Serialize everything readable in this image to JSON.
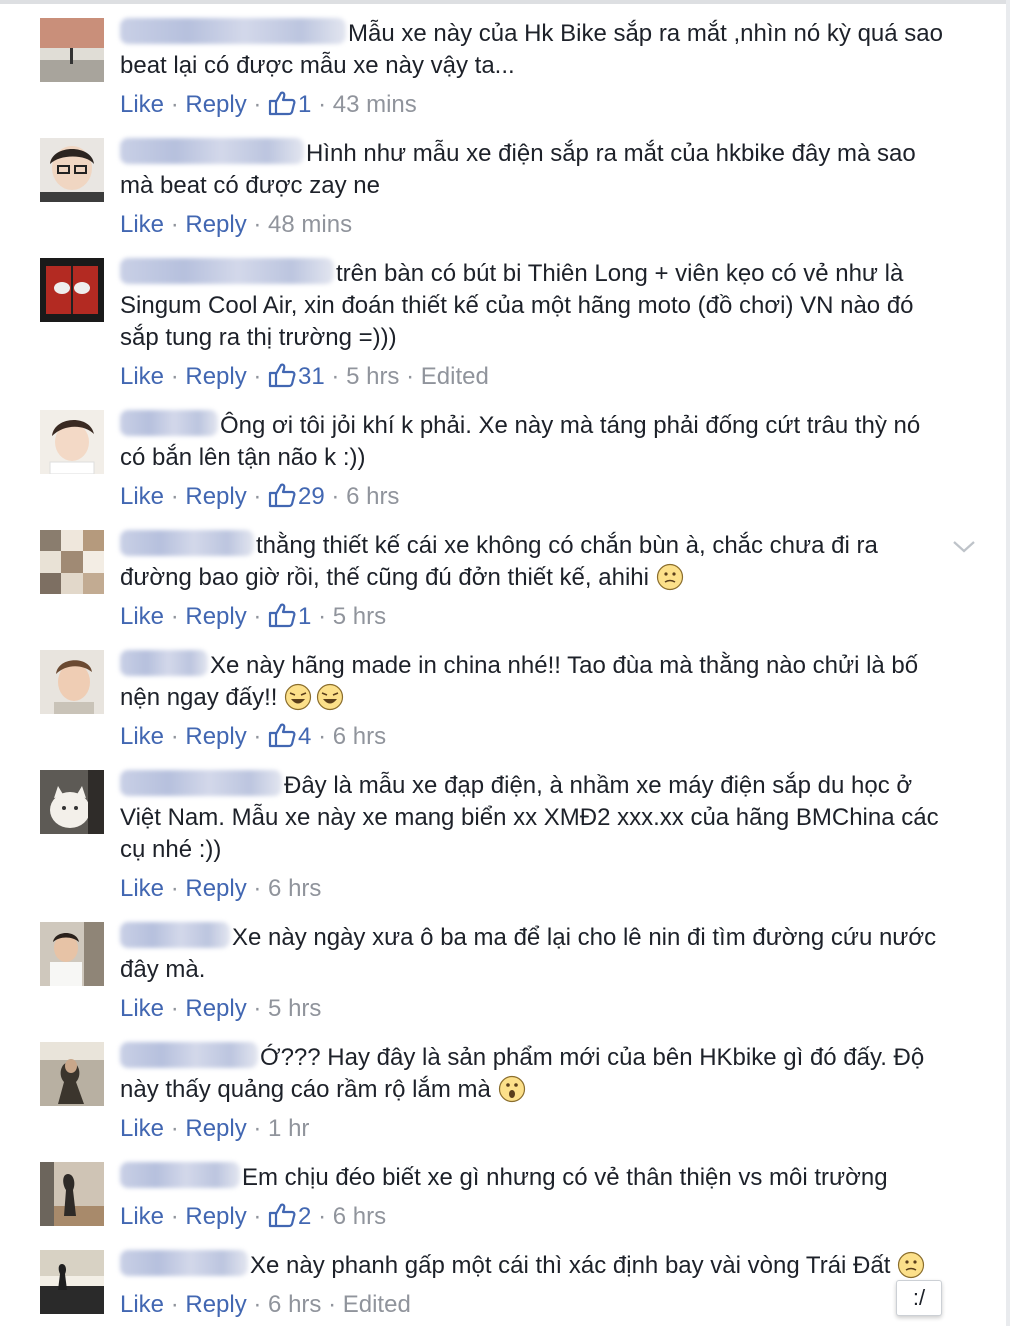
{
  "actions": {
    "like": "Like",
    "reply": "Reply",
    "sep": " · "
  },
  "comments": [
    {
      "text": "Mẫu xe này của Hk Bike sắp ra mắt ,nhìn nó kỳ quá sao beat lại có được mẫu xe này vậy ta...",
      "likes": "1",
      "time": "43 mins",
      "edited": ""
    },
    {
      "text": "Hình như mẫu xe điện sắp ra mắt của hkbike đây mà sao mà beat có được zay ne",
      "likes": "",
      "time": "48 mins",
      "edited": ""
    },
    {
      "text": "trên bàn có bút bi Thiên Long + viên kẹo có vẻ như là Singum Cool Air, xin đoán thiết kế của một hãng moto (đồ chơi) VN nào đó sắp tung ra thị trường =)))",
      "likes": "31",
      "time": "5 hrs",
      "edited": "Edited"
    },
    {
      "text": "Ông ơi tôi jỏi khí k phải. Xe này mà táng phải đống cứt trâu thỳ nó có bắn lên tận não k :))",
      "likes": "29",
      "time": "6 hrs",
      "edited": ""
    },
    {
      "text": "thằng thiết kế cái xe không có chắn bùn à, chắc chưa đi ra đường bao giờ rồi, thế cũng đú đởn thiết kế, ahihi",
      "likes": "1",
      "time": "5 hrs",
      "edited": ""
    },
    {
      "text": "Xe này hãng made in china nhé!! Tao đùa mà thằng nào chửi là bố nện ngay đấy!!",
      "likes": "4",
      "time": "6 hrs",
      "edited": ""
    },
    {
      "text": "Đây là mẫu xe đạp điện, à nhầm xe máy điện sắp du học ở Việt Nam. Mẫu xe này xe mang biển xx XMĐ2 xxx.xx của hãng BMChina các cụ nhé :))",
      "likes": "",
      "time": "6 hrs",
      "edited": ""
    },
    {
      "text": "Xe này ngày xưa ô ba ma để lại cho lê nin đi tìm đường cứu nước đây mà.",
      "likes": "",
      "time": "5 hrs",
      "edited": ""
    },
    {
      "text": "Ớ??? Hay đây là sản phẩm mới của bên HKbike gì đó đấy. Độ này thấy quảng cáo rầm rộ lắm mà",
      "likes": "",
      "time": "1 hr",
      "edited": ""
    },
    {
      "text": "Em chịu đéo biết xe gì nhưng có vẻ thân thiện vs môi trường",
      "likes": "2",
      "time": "6 hrs",
      "edited": ""
    },
    {
      "text": "Xe này phanh gấp một cái thì xác định bay vài vòng Trái Đất",
      "likes": "",
      "time": "6 hrs",
      "edited": "Edited"
    }
  ],
  "tooltip": ":/",
  "icons": {
    "like": "thumbs-up-icon",
    "expand": "chevron-down-icon"
  },
  "colors": {
    "link": "#4267b2",
    "meta": "#90949c",
    "text": "#1d2129"
  }
}
